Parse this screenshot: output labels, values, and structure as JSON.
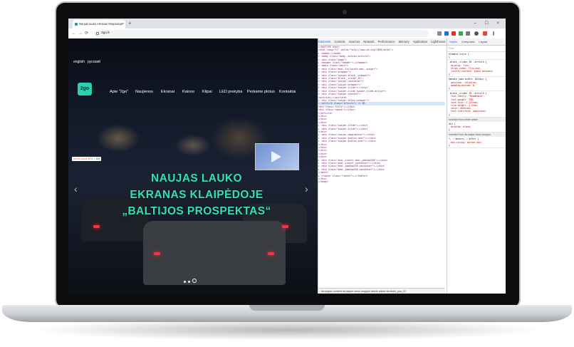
{
  "browser": {
    "tab_title": "Naujas lauko ekranas Klaipėdoje",
    "tab_close": "×",
    "new_tab": "+",
    "window_controls": "– ☐ ×",
    "back": "←",
    "forward": "→",
    "reload": "⟳",
    "url": "2go.lt"
  },
  "site": {
    "languages": [
      "english",
      "русский"
    ],
    "logo_text": "2go",
    "menu": [
      "Apie \"2go\"",
      "Naujienos",
      "Ekranai",
      "Kainos",
      "Klipai",
      "LED prekyba",
      "Perkame plotus",
      "Kontaktai"
    ],
    "element_badge": {
      "selector": "article.article",
      "size": "873 × 488"
    },
    "headline": [
      "NAUJAS LAUKO",
      "EKRANAS KLAIPĖDOJE",
      "„BALTIJOS PROSPEKTAS“"
    ],
    "arrow_left": "‹",
    "arrow_right": "›"
  },
  "devtools": {
    "tabs": [
      "Elements",
      "Console",
      "Sources",
      "Network",
      "Performance",
      "Memory",
      "Application",
      "Lighthouse"
    ],
    "active_tab": "Elements",
    "code_lines": [
      "<!DOCTYPE html>",
      "<html lang=\"lt\" xmlns=\"http://www.w3.org/1999/xhtml\">",
      "▸ <head>…</head>",
      "▾ <body class=\"body--action-article\">",
      "  ▾ <div class=\"page\">",
      "    ▸ <header class=\"header\">…</header>",
      "    ▾ <main class=\"main\">",
      "      ▾ <div class=\"mod--fullwidth mod--swiper\">",
      "        ▾ <div class=\"wrapper\">",
      "          ▾ <div class=\"swiper-block__wrapper\">",
      "            ▾ <div class=\"block__slider_01\">",
      "              ▾ <div class=\"swiper-container\">",
      "                ▾ <div class=\"swiper-wrapper\">",
      "                  ▸ <div class=\"swiper-slide\">…</div>",
      "                  ▾ <div class=\"swiper-slide swiper-slide-active\">",
      "                    ▾ <div class=\"swiper-content\">",
      "                      <picture>…</picture>",
      "                      ▾ <div class=\"swiper-block-wrapper\">",
      "                        ▾ <article class=\"article\"> == $0",
      "                          <div class=\"title\">…</div>",
      "                          <div class=\"space\">…</div>",
      "                        </article>",
      "                      </div>",
      "                    </div>",
      "                  </div>",
      "                  ▸ <div class=\"swiper-slide\">…</div>",
      "                  ▸ <div class=\"swiper-slide\">…</div>",
      "                </div>",
      "                ▸ <div class=\"swiper-pagination\">…</div>",
      "                ▸ <div class=\"swiper-button-next\">…</div>",
      "                ▸ <div class=\"swiper-button-prev\">…</div>",
      "              </div>",
      "            </div>",
      "          </div>",
      "        </div>",
      "      </div>",
      "      ▸ <div class=\"mod--invert mod--padtop150\">…</div>",
      "      ▸ <div class=\"mod--invert container\">…</div>",
      "      ▸ <div class=\"mod--padtop150 container\">…</div>",
      "      ▸ <div class=\"mod--padtop150 container\">…</div>",
      "    </main>",
      "    ▸ <footer class=\"footer\">…</footer>",
      "  </div>",
      "</body>"
    ],
    "breadcrumb": "... div.swiper-content  div.swiper-block-wrapper  article.article  div.slider_pos_01",
    "styles_tabs": [
      "Styles",
      "Computed",
      "Layout"
    ],
    "filter_placeholder": "Filter",
    "rules": [
      {
        "selector": "element.style {",
        "props": []
      },
      {
        "selector": ".block__slider_01 .article {",
        "props": [
          "display: flex;",
          "align-items: flex-end;",
          "justify-content: space-between;"
        ]
      },
      {
        "selector": "@media (max-width: 1024px) {",
        "props": [
          "position: relative;",
          "padding-bottom: 0;"
        ]
      },
      {
        "selector": ".block__slider_01 .article {",
        "props": [
          "font-family: \"RoadRadio\";",
          "font-weight: 700;",
          "font-size: 3.125rem;",
          "line-height: 3.4rem;",
          "color: #45e1a4;",
          "text-transform: uppercase;"
        ]
      },
      {
        "selector": "div {",
        "props": [
          "display: block;"
        ]
      },
      {
        "selector": "*, ::before, ::after {",
        "props": [
          "box-sizing: border-box;"
        ]
      }
    ],
    "inherited": [
      "Inherited from article.article",
      "Inherited from div.swiper-block-wrapper"
    ]
  },
  "colors": {
    "accent": "#33e0b4",
    "logo": "#2bd0b0",
    "devtools_active": "#1a73e8"
  }
}
